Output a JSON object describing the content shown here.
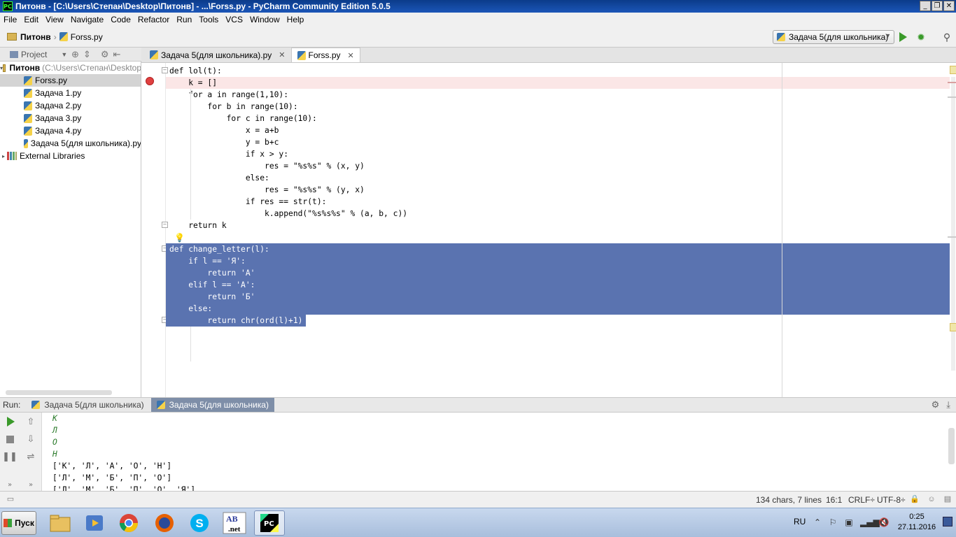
{
  "window": {
    "title": "Питонв - [C:\\Users\\Степан\\Desktop\\Питонв] - ...\\Forss.py - PyCharm Community Edition 5.0.5",
    "icon_text": "PC",
    "buttons": [
      "_",
      "❐",
      "✕"
    ]
  },
  "menu": [
    "File",
    "Edit",
    "View",
    "Navigate",
    "Code",
    "Refactor",
    "Run",
    "Tools",
    "VCS",
    "Window",
    "Help"
  ],
  "navbar": {
    "crumbs": [
      "Питонв",
      "Forss.py"
    ],
    "run_config": "Задача 5(для школьника)"
  },
  "project_panel": {
    "header": "Project",
    "root_name": "Питонв",
    "root_path": "(C:\\Users\\Степан\\Desktop",
    "files": [
      "Forss.py",
      "Задача 1.py",
      "Задача 2.py",
      "Задача 3.py",
      "Задача 4.py",
      "Задача 5(для школьника).py"
    ],
    "libraries": "External Libraries"
  },
  "editor_tabs": [
    {
      "label": "Задача 5(для школьника).py",
      "close": "✕"
    },
    {
      "label": "Forss.py",
      "close": "✕"
    }
  ],
  "code": [
    "def lol(t):",
    "    k = []",
    "    for a in range(1,10):",
    "        for b in range(10):",
    "            for c in range(10):",
    "                x = a+b",
    "                y = b+c",
    "                if x > y:",
    "                    res = \"%s%s\" % (x, y)",
    "                else:",
    "                    res = \"%s%s\" % (y, x)",
    "                if res == str(t):",
    "                    k.append(\"%s%s%s\" % (a, b, c))",
    "    return k",
    "",
    "def change_letter(l):",
    "    if l == 'Я':",
    "        return 'А'",
    "    elif l == 'А':",
    "        return 'Б'",
    "    else:",
    "        return chr(ord(l)+1)"
  ],
  "run_panel": {
    "label": "Run:",
    "tabs": [
      "Задача 5(для школьника)",
      "Задача 5(для школьника)"
    ],
    "output": [
      "К",
      "Л",
      "О",
      "Н",
      "['К', 'Л', 'А', 'О', 'Н']",
      "['Л', 'М', 'Б', 'П', 'О']",
      "['Л', 'М', 'Б', 'П', 'О', 'Я']"
    ]
  },
  "statusbar": {
    "chars": "134 chars, 7 lines",
    "position": "16:1",
    "line_sep": "CRLF÷",
    "encoding": "UTF-8÷"
  },
  "taskbar": {
    "start": "Пуск",
    "apps": [
      "file-explorer",
      "media-player",
      "chrome",
      "firefox",
      "skype",
      "abc-net",
      "pycharm"
    ],
    "lang": "RU",
    "time": "0:25",
    "date": "27.11.2016"
  }
}
